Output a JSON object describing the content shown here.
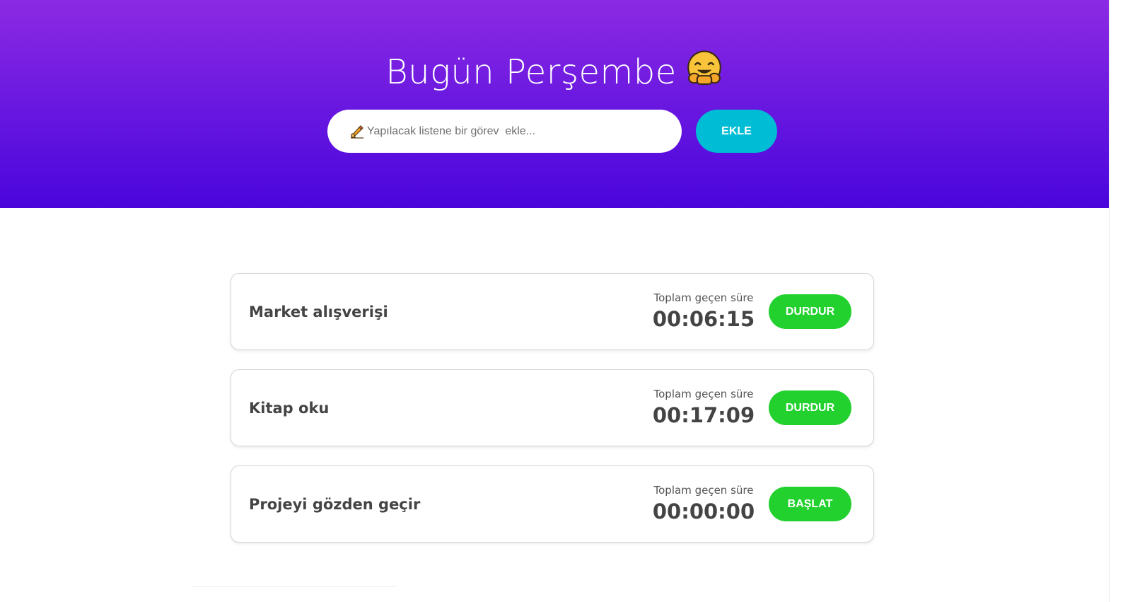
{
  "header": {
    "title": "Bugün Perşembe",
    "title_emoji_icon": "hugging-face-emoji-icon",
    "input_placeholder": "Yapılacak listene bir görev  ekle...",
    "input_icon": "writing-hand-icon",
    "add_button_label": "EKLE",
    "gradient_top": "#8c2ae3",
    "gradient_bottom": "#4a05dc"
  },
  "colors": {
    "add_button": "#00bcd4",
    "action_button": "#22d12e",
    "text_dark": "#444444"
  },
  "tasks": [
    {
      "name": "Market alışverişi",
      "timer_label": "Toplam geçen süre",
      "elapsed": "00:06:15",
      "action_label": "DURDUR"
    },
    {
      "name": "Kitap oku",
      "timer_label": "Toplam geçen süre",
      "elapsed": "00:17:09",
      "action_label": "DURDUR"
    },
    {
      "name": "Projeyi gözden geçir",
      "timer_label": "Toplam geçen süre",
      "elapsed": "00:00:00",
      "action_label": "BAŞLAT"
    }
  ]
}
